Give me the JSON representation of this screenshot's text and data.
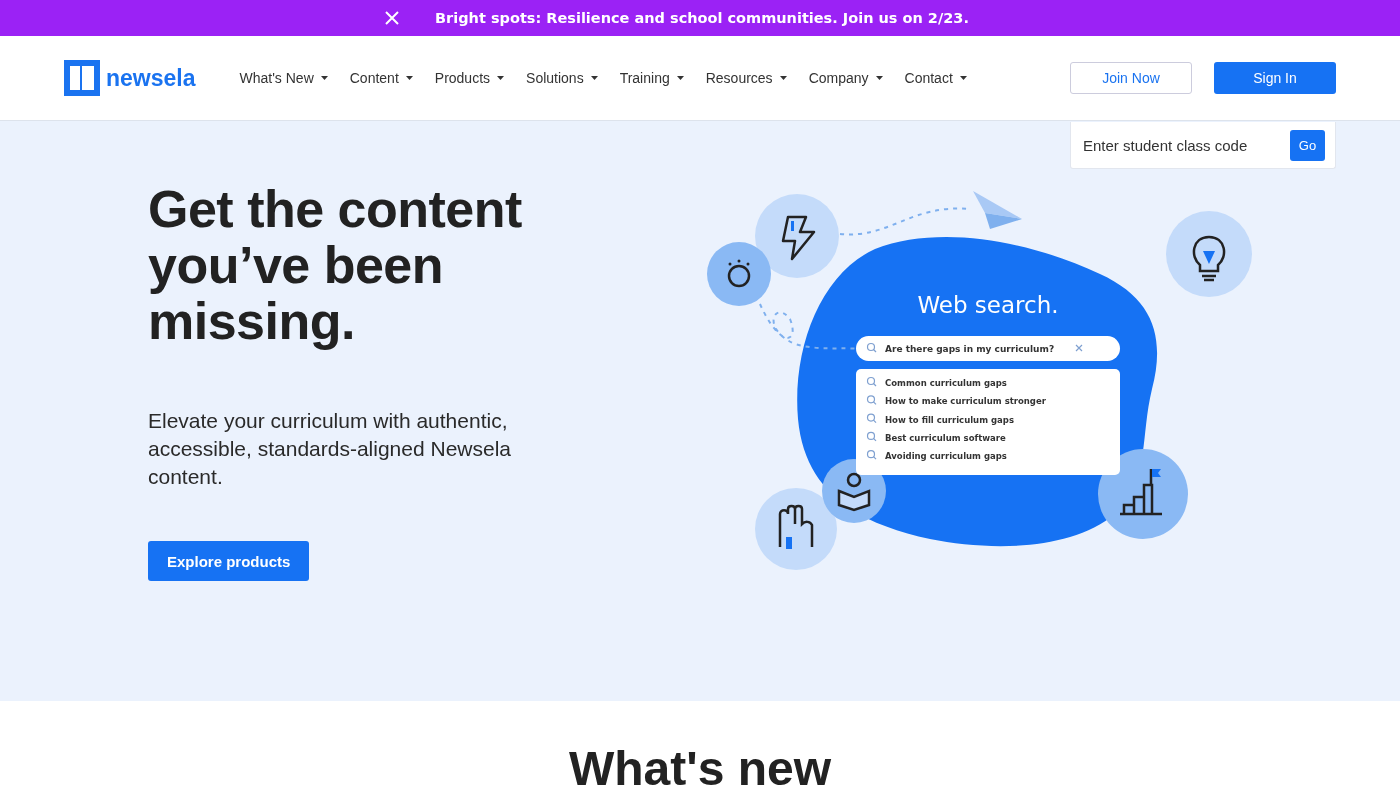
{
  "announcement": {
    "text": "Bright spots: Resilience and school communities. Join us on 2/23."
  },
  "header": {
    "logo": "newsela",
    "nav": [
      {
        "label": "What's New"
      },
      {
        "label": "Content"
      },
      {
        "label": "Products"
      },
      {
        "label": "Solutions"
      },
      {
        "label": "Training"
      },
      {
        "label": "Resources"
      },
      {
        "label": "Company"
      },
      {
        "label": "Contact"
      }
    ],
    "join_button": "Join Now",
    "sign_in_button": "Sign In"
  },
  "class_code": {
    "placeholder": "Enter student class code",
    "button": "Go"
  },
  "hero": {
    "heading": "Get the content you’ve been missing.",
    "body": "Elevate your curriculum with authentic, accessible, standards-aligned Newsela content.",
    "cta": "Explore products",
    "illustration": {
      "title": "Web search.",
      "query": "Are there gaps in my curriculum?",
      "suggestions": [
        "Common curriculum gaps",
        "How to make curriculum stronger",
        "How to fill curriculum gaps",
        "Best curriculum software",
        "Avoiding curriculum gaps"
      ]
    }
  },
  "next_section": {
    "heading": "What's new"
  }
}
